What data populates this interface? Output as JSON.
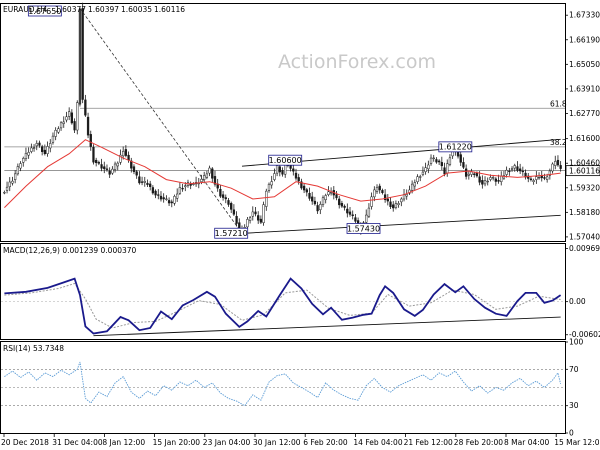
{
  "chart_data": [
    {
      "type": "candlestick",
      "title": "EURAUD,H4",
      "ohlc": [
        "1.60377",
        "1.60397",
        "1.60035",
        "1.60116"
      ],
      "watermark": "ActionForex.com",
      "current_price": "1.60116",
      "yticks": [
        "1.67330",
        "1.66190",
        "1.65050",
        "1.63910",
        "1.62770",
        "1.61600",
        "1.60460",
        "1.59320",
        "1.58180",
        "1.57040"
      ],
      "ylim": [
        1.5685,
        1.6785
      ],
      "xticks": [
        "20 Dec 2018",
        "31 Dec 04:00",
        "8 Jan 12:00",
        "15 Jan 20:00",
        "23 Jan 04:00",
        "30 Jan 12:00",
        "6 Feb 20:00",
        "14 Feb 04:00",
        "21 Feb 12:00",
        "28 Feb 20:00",
        "8 Mar 04:00",
        "15 Mar 12:00"
      ],
      "price_path": [
        {
          "x": 0,
          "y": 1.592
        },
        {
          "x": 3,
          "y": 1.597
        },
        {
          "x": 6,
          "y": 1.605
        },
        {
          "x": 9,
          "y": 1.61
        },
        {
          "x": 12,
          "y": 1.614
        },
        {
          "x": 15,
          "y": 1.609
        },
        {
          "x": 18,
          "y": 1.617
        },
        {
          "x": 21,
          "y": 1.623
        },
        {
          "x": 24,
          "y": 1.628
        },
        {
          "x": 26,
          "y": 1.62
        },
        {
          "x": 27,
          "y": 1.632
        },
        {
          "x": 28,
          "y": 1.6765
        },
        {
          "x": 29,
          "y": 1.634
        },
        {
          "x": 31,
          "y": 1.618
        },
        {
          "x": 33,
          "y": 1.606
        },
        {
          "x": 36,
          "y": 1.603
        },
        {
          "x": 39,
          "y": 1.6
        },
        {
          "x": 42,
          "y": 1.605
        },
        {
          "x": 44,
          "y": 1.611
        },
        {
          "x": 47,
          "y": 1.603
        },
        {
          "x": 50,
          "y": 1.596
        },
        {
          "x": 53,
          "y": 1.595
        },
        {
          "x": 56,
          "y": 1.59
        },
        {
          "x": 59,
          "y": 1.588
        },
        {
          "x": 62,
          "y": 1.586
        },
        {
          "x": 65,
          "y": 1.593
        },
        {
          "x": 68,
          "y": 1.595
        },
        {
          "x": 71,
          "y": 1.595
        },
        {
          "x": 74,
          "y": 1.598
        },
        {
          "x": 76,
          "y": 1.602
        },
        {
          "x": 78,
          "y": 1.595
        },
        {
          "x": 80,
          "y": 1.59
        },
        {
          "x": 83,
          "y": 1.586
        },
        {
          "x": 85,
          "y": 1.58
        },
        {
          "x": 87,
          "y": 1.574
        },
        {
          "x": 88,
          "y": 1.5721
        },
        {
          "x": 90,
          "y": 1.578
        },
        {
          "x": 92,
          "y": 1.582
        },
        {
          "x": 95,
          "y": 1.577
        },
        {
          "x": 97,
          "y": 1.592
        },
        {
          "x": 99,
          "y": 1.597
        },
        {
          "x": 101,
          "y": 1.603
        },
        {
          "x": 103,
          "y": 1.5995
        },
        {
          "x": 104,
          "y": 1.606
        },
        {
          "x": 106,
          "y": 1.602
        },
        {
          "x": 108,
          "y": 1.598
        },
        {
          "x": 110,
          "y": 1.594
        },
        {
          "x": 113,
          "y": 1.589
        },
        {
          "x": 116,
          "y": 1.583
        },
        {
          "x": 119,
          "y": 1.59
        },
        {
          "x": 121,
          "y": 1.592
        },
        {
          "x": 124,
          "y": 1.586
        },
        {
          "x": 127,
          "y": 1.582
        },
        {
          "x": 130,
          "y": 1.578
        },
        {
          "x": 132,
          "y": 1.5743
        },
        {
          "x": 134,
          "y": 1.58
        },
        {
          "x": 136,
          "y": 1.589
        },
        {
          "x": 138,
          "y": 1.594
        },
        {
          "x": 141,
          "y": 1.588
        },
        {
          "x": 144,
          "y": 1.584
        },
        {
          "x": 147,
          "y": 1.588
        },
        {
          "x": 150,
          "y": 1.592
        },
        {
          "x": 153,
          "y": 1.598
        },
        {
          "x": 156,
          "y": 1.602
        },
        {
          "x": 158,
          "y": 1.607
        },
        {
          "x": 161,
          "y": 1.605
        },
        {
          "x": 163,
          "y": 1.6
        },
        {
          "x": 165,
          "y": 1.608
        },
        {
          "x": 167,
          "y": 1.6122
        },
        {
          "x": 169,
          "y": 1.605
        },
        {
          "x": 171,
          "y": 1.599
        },
        {
          "x": 174,
          "y": 1.6
        },
        {
          "x": 177,
          "y": 1.595
        },
        {
          "x": 180,
          "y": 1.598
        },
        {
          "x": 183,
          "y": 1.596
        },
        {
          "x": 186,
          "y": 1.601
        },
        {
          "x": 189,
          "y": 1.603
        },
        {
          "x": 192,
          "y": 1.6
        },
        {
          "x": 195,
          "y": 1.596
        },
        {
          "x": 198,
          "y": 1.599
        },
        {
          "x": 200,
          "y": 1.597
        },
        {
          "x": 202,
          "y": 1.601
        },
        {
          "x": 204,
          "y": 1.606
        },
        {
          "x": 206,
          "y": 1.6012
        }
      ],
      "moving_average": [
        {
          "x": 0,
          "y": 1.584
        },
        {
          "x": 8,
          "y": 1.594
        },
        {
          "x": 16,
          "y": 1.603
        },
        {
          "x": 24,
          "y": 1.609
        },
        {
          "x": 30,
          "y": 1.6155
        },
        {
          "x": 36,
          "y": 1.612
        },
        {
          "x": 44,
          "y": 1.607
        },
        {
          "x": 52,
          "y": 1.603
        },
        {
          "x": 60,
          "y": 1.597
        },
        {
          "x": 68,
          "y": 1.595
        },
        {
          "x": 76,
          "y": 1.596
        },
        {
          "x": 84,
          "y": 1.593
        },
        {
          "x": 92,
          "y": 1.588
        },
        {
          "x": 100,
          "y": 1.589
        },
        {
          "x": 108,
          "y": 1.596
        },
        {
          "x": 116,
          "y": 1.594
        },
        {
          "x": 124,
          "y": 1.59
        },
        {
          "x": 132,
          "y": 1.587
        },
        {
          "x": 140,
          "y": 1.588
        },
        {
          "x": 148,
          "y": 1.59
        },
        {
          "x": 156,
          "y": 1.594
        },
        {
          "x": 164,
          "y": 1.6
        },
        {
          "x": 172,
          "y": 1.601
        },
        {
          "x": 180,
          "y": 1.599
        },
        {
          "x": 190,
          "y": 1.598
        },
        {
          "x": 200,
          "y": 1.599
        },
        {
          "x": 206,
          "y": 1.6
        }
      ],
      "trendlines": [
        {
          "from": {
            "x": 89,
            "y": 1.5721
          },
          "to": {
            "x": 206,
            "y": 1.5804
          }
        },
        {
          "from": {
            "x": 88,
            "y": 1.6032
          },
          "to": {
            "x": 206,
            "y": 1.6157
          }
        }
      ],
      "dashed_line": {
        "from": {
          "x": 28,
          "y": 1.6765
        },
        "to": {
          "x": 88,
          "y": 1.5721
        }
      },
      "horizontal_levels": [
        {
          "value": 1.6301,
          "label": "61.8",
          "x_start": 28
        },
        {
          "value": 1.6122,
          "label": "38.2",
          "x_start": 0
        },
        {
          "value": 1.6012,
          "label": "",
          "x_start": 0
        }
      ],
      "annotations": [
        {
          "text": "1.67650",
          "x": 15,
          "y": 1.6765
        },
        {
          "text": "1.60600",
          "x": 104,
          "y": 1.606
        },
        {
          "text": "1.61220",
          "x": 167,
          "y": 1.6122
        },
        {
          "text": "1.57210",
          "x": 84,
          "y": 1.5721
        },
        {
          "text": "1.57430",
          "x": 133,
          "y": 1.5743
        }
      ],
      "colors": {
        "candle": "#1a1a1a",
        "ma": "#e53935",
        "trendline": "#111111",
        "level": "#888888",
        "box_border": "#1c1c8c"
      }
    },
    {
      "type": "line",
      "title": "MACD(12,26,9) 0.001239 0.000370",
      "yticks": [
        "0.009695",
        "0.00",
        "-0.006025"
      ],
      "ylim": [
        -0.0068,
        0.0105
      ],
      "macd": [
        {
          "x": 0,
          "y": 0.0015
        },
        {
          "x": 8,
          "y": 0.0018
        },
        {
          "x": 16,
          "y": 0.0025
        },
        {
          "x": 22,
          "y": 0.0035
        },
        {
          "x": 26,
          "y": 0.0042
        },
        {
          "x": 28,
          "y": 0.0012
        },
        {
          "x": 30,
          "y": -0.0045
        },
        {
          "x": 33,
          "y": -0.0058
        },
        {
          "x": 38,
          "y": -0.0054
        },
        {
          "x": 43,
          "y": -0.0028
        },
        {
          "x": 46,
          "y": -0.0034
        },
        {
          "x": 50,
          "y": -0.0052
        },
        {
          "x": 54,
          "y": -0.0048
        },
        {
          "x": 58,
          "y": -0.0018
        },
        {
          "x": 62,
          "y": -0.0032
        },
        {
          "x": 66,
          "y": -0.0007
        },
        {
          "x": 70,
          "y": 0.0003
        },
        {
          "x": 75,
          "y": 0.0018
        },
        {
          "x": 78,
          "y": 0.0009
        },
        {
          "x": 82,
          "y": -0.0022
        },
        {
          "x": 87,
          "y": -0.0046
        },
        {
          "x": 90,
          "y": -0.0036
        },
        {
          "x": 94,
          "y": -0.0017
        },
        {
          "x": 97,
          "y": -0.0027
        },
        {
          "x": 102,
          "y": 0.0012
        },
        {
          "x": 106,
          "y": 0.0042
        },
        {
          "x": 110,
          "y": 0.0024
        },
        {
          "x": 114,
          "y": -0.0004
        },
        {
          "x": 118,
          "y": -0.0023
        },
        {
          "x": 121,
          "y": -0.0011
        },
        {
          "x": 125,
          "y": -0.0033
        },
        {
          "x": 129,
          "y": -0.0029
        },
        {
          "x": 133,
          "y": -0.0024
        },
        {
          "x": 136,
          "y": -0.0022
        },
        {
          "x": 139,
          "y": 0.0012
        },
        {
          "x": 141,
          "y": 0.0028
        },
        {
          "x": 144,
          "y": 0.0016
        },
        {
          "x": 148,
          "y": -0.0014
        },
        {
          "x": 152,
          "y": -0.0026
        },
        {
          "x": 155,
          "y": -0.0015
        },
        {
          "x": 159,
          "y": 0.0013
        },
        {
          "x": 163,
          "y": 0.0032
        },
        {
          "x": 167,
          "y": 0.0017
        },
        {
          "x": 170,
          "y": 0.0028
        },
        {
          "x": 174,
          "y": 0.0005
        },
        {
          "x": 178,
          "y": -0.0011
        },
        {
          "x": 182,
          "y": -0.0022
        },
        {
          "x": 186,
          "y": -0.0026
        },
        {
          "x": 190,
          "y": 0.0001
        },
        {
          "x": 193,
          "y": 0.0016
        },
        {
          "x": 197,
          "y": 0.0016
        },
        {
          "x": 200,
          "y": -0.0002
        },
        {
          "x": 203,
          "y": 0.0002
        },
        {
          "x": 206,
          "y": 0.0012
        }
      ],
      "signal": [
        {
          "x": 0,
          "y": 0.0012
        },
        {
          "x": 10,
          "y": 0.0016
        },
        {
          "x": 20,
          "y": 0.0024
        },
        {
          "x": 26,
          "y": 0.0033
        },
        {
          "x": 30,
          "y": 0.0005
        },
        {
          "x": 34,
          "y": -0.0032
        },
        {
          "x": 40,
          "y": -0.0048
        },
        {
          "x": 48,
          "y": -0.0038
        },
        {
          "x": 56,
          "y": -0.0036
        },
        {
          "x": 64,
          "y": -0.0018
        },
        {
          "x": 72,
          "y": 0.0002
        },
        {
          "x": 80,
          "y": -0.0005
        },
        {
          "x": 88,
          "y": -0.0034
        },
        {
          "x": 96,
          "y": -0.0024
        },
        {
          "x": 104,
          "y": 0.0016
        },
        {
          "x": 112,
          "y": 0.0021
        },
        {
          "x": 120,
          "y": -0.0012
        },
        {
          "x": 128,
          "y": -0.0025
        },
        {
          "x": 136,
          "y": -0.0021
        },
        {
          "x": 142,
          "y": 0.0013
        },
        {
          "x": 150,
          "y": -0.0008
        },
        {
          "x": 158,
          "y": -0.0002
        },
        {
          "x": 166,
          "y": 0.0021
        },
        {
          "x": 174,
          "y": 0.0013
        },
        {
          "x": 182,
          "y": -0.0014
        },
        {
          "x": 190,
          "y": -0.0008
        },
        {
          "x": 198,
          "y": 0.001
        },
        {
          "x": 206,
          "y": 0.0004
        }
      ],
      "trendline": {
        "from": {
          "x": 33,
          "y": -0.0062
        },
        "to": {
          "x": 206,
          "y": -0.0028
        }
      },
      "colors": {
        "macd": "#1a1a8c",
        "signal": "#999999"
      }
    },
    {
      "type": "line",
      "title": "RSI(14) 53.7348",
      "yticks": [
        "100",
        "70",
        "30",
        "0"
      ],
      "ylim": [
        0,
        100
      ],
      "levels": [
        70,
        50,
        30
      ],
      "rsi": [
        {
          "x": 0,
          "y": 62
        },
        {
          "x": 3,
          "y": 68
        },
        {
          "x": 6,
          "y": 61
        },
        {
          "x": 9,
          "y": 67
        },
        {
          "x": 12,
          "y": 58
        },
        {
          "x": 15,
          "y": 66
        },
        {
          "x": 18,
          "y": 62
        },
        {
          "x": 21,
          "y": 69
        },
        {
          "x": 24,
          "y": 64
        },
        {
          "x": 27,
          "y": 70
        },
        {
          "x": 28,
          "y": 78
        },
        {
          "x": 30,
          "y": 38
        },
        {
          "x": 32,
          "y": 33
        },
        {
          "x": 35,
          "y": 45
        },
        {
          "x": 38,
          "y": 40
        },
        {
          "x": 41,
          "y": 55
        },
        {
          "x": 44,
          "y": 62
        },
        {
          "x": 47,
          "y": 45
        },
        {
          "x": 50,
          "y": 38
        },
        {
          "x": 53,
          "y": 46
        },
        {
          "x": 56,
          "y": 41
        },
        {
          "x": 59,
          "y": 52
        },
        {
          "x": 62,
          "y": 47
        },
        {
          "x": 65,
          "y": 56
        },
        {
          "x": 68,
          "y": 52
        },
        {
          "x": 71,
          "y": 58
        },
        {
          "x": 74,
          "y": 50
        },
        {
          "x": 77,
          "y": 55
        },
        {
          "x": 80,
          "y": 44
        },
        {
          "x": 83,
          "y": 38
        },
        {
          "x": 86,
          "y": 35
        },
        {
          "x": 89,
          "y": 30
        },
        {
          "x": 92,
          "y": 42
        },
        {
          "x": 95,
          "y": 36
        },
        {
          "x": 98,
          "y": 56
        },
        {
          "x": 101,
          "y": 63
        },
        {
          "x": 104,
          "y": 65
        },
        {
          "x": 107,
          "y": 55
        },
        {
          "x": 110,
          "y": 50
        },
        {
          "x": 113,
          "y": 45
        },
        {
          "x": 116,
          "y": 39
        },
        {
          "x": 119,
          "y": 55
        },
        {
          "x": 122,
          "y": 47
        },
        {
          "x": 125,
          "y": 42
        },
        {
          "x": 128,
          "y": 38
        },
        {
          "x": 131,
          "y": 36
        },
        {
          "x": 134,
          "y": 52
        },
        {
          "x": 137,
          "y": 60
        },
        {
          "x": 140,
          "y": 50
        },
        {
          "x": 143,
          "y": 45
        },
        {
          "x": 146,
          "y": 52
        },
        {
          "x": 149,
          "y": 56
        },
        {
          "x": 152,
          "y": 60
        },
        {
          "x": 155,
          "y": 64
        },
        {
          "x": 158,
          "y": 58
        },
        {
          "x": 161,
          "y": 66
        },
        {
          "x": 164,
          "y": 62
        },
        {
          "x": 167,
          "y": 68
        },
        {
          "x": 170,
          "y": 56
        },
        {
          "x": 173,
          "y": 46
        },
        {
          "x": 176,
          "y": 52
        },
        {
          "x": 179,
          "y": 44
        },
        {
          "x": 182,
          "y": 50
        },
        {
          "x": 185,
          "y": 47
        },
        {
          "x": 188,
          "y": 55
        },
        {
          "x": 191,
          "y": 60
        },
        {
          "x": 194,
          "y": 52
        },
        {
          "x": 197,
          "y": 57
        },
        {
          "x": 200,
          "y": 50
        },
        {
          "x": 203,
          "y": 58
        },
        {
          "x": 205,
          "y": 66
        },
        {
          "x": 206,
          "y": 54
        }
      ],
      "colors": {
        "rsi": "#5a9bd5",
        "level": "#777777"
      }
    }
  ]
}
